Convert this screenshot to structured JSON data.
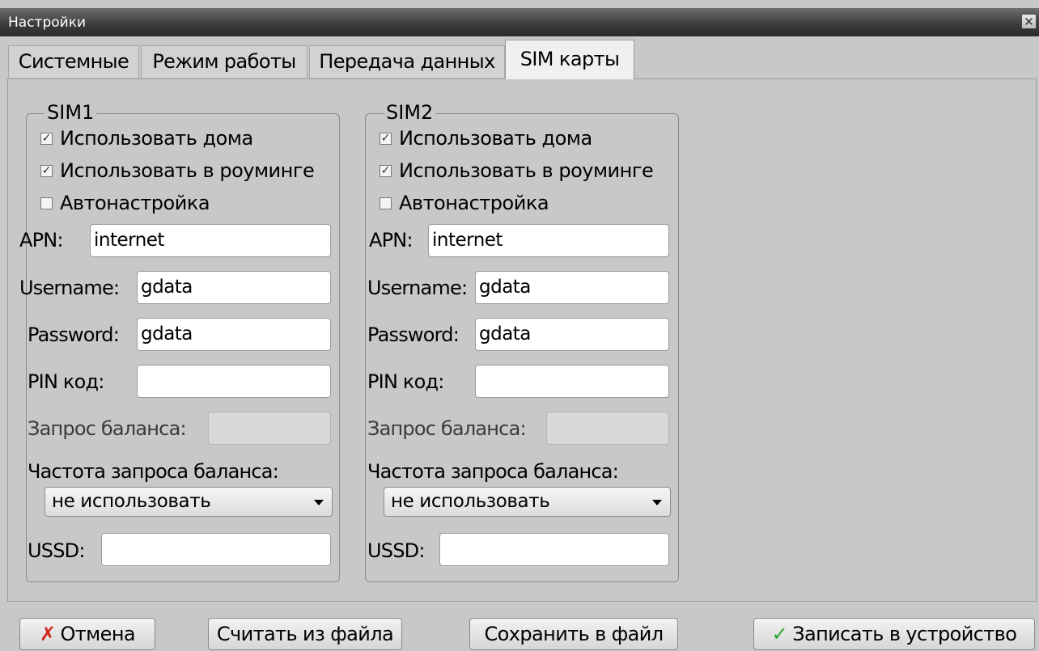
{
  "window": {
    "title": "Настройки",
    "close_icon": "close-icon"
  },
  "tabs": [
    {
      "label": "Системные",
      "active": false
    },
    {
      "label": "Режим работы",
      "active": false
    },
    {
      "label": "Передача данных",
      "active": false
    },
    {
      "label": "SIM карты",
      "active": true
    }
  ],
  "sims": [
    {
      "legend": "SIM1",
      "use_home": {
        "label": "Использовать дома",
        "checked": true
      },
      "use_roaming": {
        "label": "Использовать в роуминге",
        "checked": true
      },
      "autoconfig": {
        "label": "Автонастройка",
        "checked": false
      },
      "apn": {
        "label": "APN:",
        "value": "internet"
      },
      "username": {
        "label": "Username:",
        "value": "gdata"
      },
      "password": {
        "label": "Password:",
        "value": "gdata"
      },
      "pin": {
        "label": "PIN код:",
        "value": ""
      },
      "balance_request": {
        "label": "Запрос баланса:",
        "value": ""
      },
      "balance_freq": {
        "label": "Частота запроса баланса:",
        "value": "не использовать"
      },
      "ussd": {
        "label": "USSD:",
        "value": ""
      }
    },
    {
      "legend": "SIM2",
      "use_home": {
        "label": "Использовать дома",
        "checked": true
      },
      "use_roaming": {
        "label": "Использовать в роуминге",
        "checked": true
      },
      "autoconfig": {
        "label": "Автонастройка",
        "checked": false
      },
      "apn": {
        "label": "APN:",
        "value": "internet"
      },
      "username": {
        "label": "Username:",
        "value": "gdata"
      },
      "password": {
        "label": "Password:",
        "value": "gdata"
      },
      "pin": {
        "label": "PIN код:",
        "value": ""
      },
      "balance_request": {
        "label": "Запрос баланса:",
        "value": ""
      },
      "balance_freq": {
        "label": "Частота запроса баланса:",
        "value": "не использовать"
      },
      "ussd": {
        "label": "USSD:",
        "value": ""
      }
    }
  ],
  "buttons": {
    "cancel": "Отмена",
    "read_file": "Считать из файла",
    "save_file": "Сохранить в файл",
    "write_device": "Записать в устройство"
  },
  "colors": {
    "cancel_icon": "#d4271b",
    "ok_icon": "#29a52c",
    "titlebar": "#3e3e3e"
  },
  "icons": {
    "check_mark": "✓",
    "cancel_mark": "✗"
  }
}
